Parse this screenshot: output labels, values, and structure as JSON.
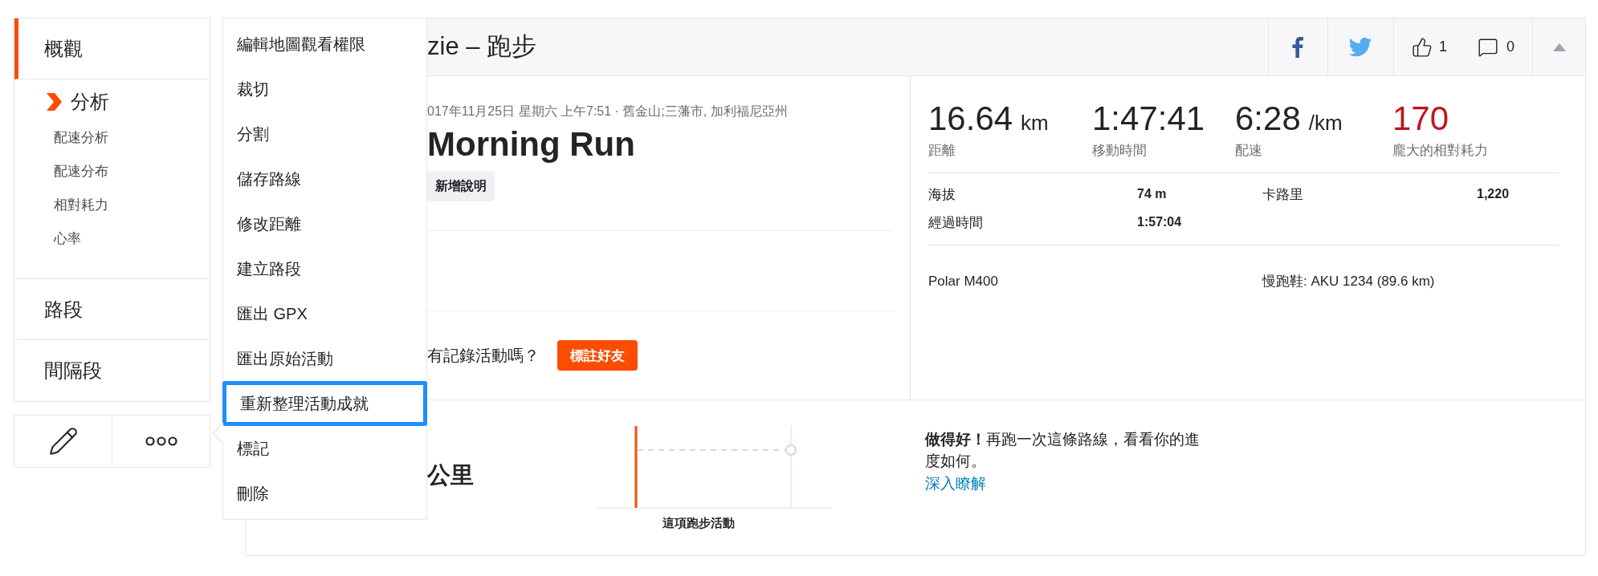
{
  "sidebar": {
    "items": [
      {
        "label": "概觀",
        "kind": "item",
        "selected": true
      },
      {
        "label": "分析",
        "kind": "group",
        "selected": false,
        "current": true,
        "children": [
          {
            "label": "配速分析"
          },
          {
            "label": "配速分布"
          },
          {
            "label": "相對耗力"
          },
          {
            "label": "心率"
          }
        ]
      },
      {
        "label": "路段",
        "kind": "item",
        "selected": false
      },
      {
        "label": "間隔段",
        "kind": "item",
        "selected": false
      }
    ]
  },
  "menu": {
    "items": [
      {
        "label": "編輯地圖觀看權限",
        "selected": false
      },
      {
        "label": "裁切",
        "selected": false
      },
      {
        "label": "分割",
        "selected": false
      },
      {
        "label": "儲存路線",
        "selected": false
      },
      {
        "label": "修改距離",
        "selected": false
      },
      {
        "label": "建立路段",
        "selected": false
      },
      {
        "label": "匯出 GPX",
        "selected": false
      },
      {
        "label": "匯出原始活動",
        "selected": false
      },
      {
        "label": "重新整理活動成就",
        "selected": true
      },
      {
        "label": "標記",
        "selected": false
      },
      {
        "label": "刪除",
        "selected": false
      }
    ]
  },
  "header": {
    "title": "zie – 跑步",
    "kudos": "1",
    "comments": "0"
  },
  "activity": {
    "meta": "017年11月25日 星期六 上午7:51 · 舊金山;三藩市, 加利福尼亞州",
    "name": "Morning Run",
    "add_description": "新增說明",
    "tag_prompt": "有記錄活動嗎？",
    "tag_button": "標註好友"
  },
  "stats": [
    {
      "value": "16.64",
      "unit": "km",
      "label": "距離",
      "kind": "normal"
    },
    {
      "value": "1:47:41",
      "label": "移動時間",
      "kind": "normal"
    },
    {
      "value": "6:28",
      "unit": "/km",
      "label": "配速",
      "kind": "normal"
    },
    {
      "value": "170",
      "label": "龐大的相對耗力",
      "kind": "alert"
    }
  ],
  "details": [
    {
      "label": "海拔",
      "value": "74 m"
    },
    {
      "label": "卡路里",
      "value": "1,220"
    },
    {
      "label": "經過時間",
      "value": "1:57:04"
    }
  ],
  "device": "Polar M400",
  "shoes": "慢跑鞋: AKU 1234 (89.6 km)",
  "segment": {
    "title": "公里",
    "chart_label": "這項跑步活動",
    "message": "**做得好！**再跑一次這條路線，看看你的進度如何。",
    "link": "深入瞭解"
  }
}
